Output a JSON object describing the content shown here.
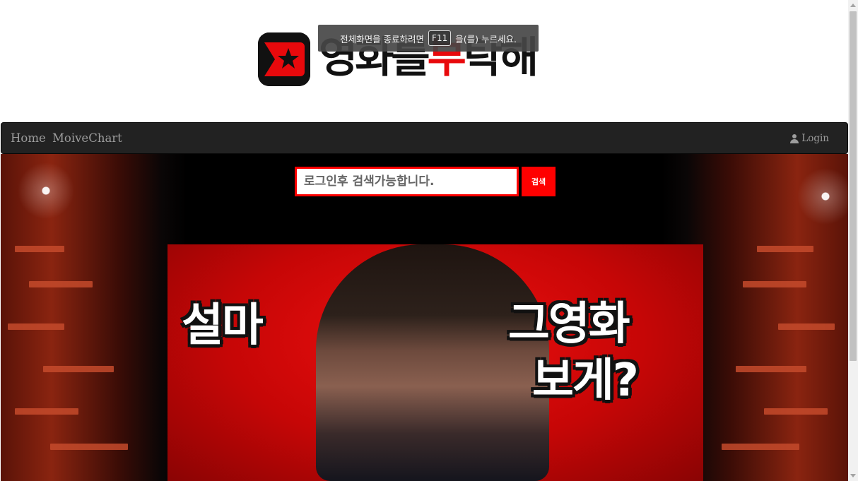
{
  "header": {
    "logo_text_black_1": "영화를",
    "logo_text_red": "부",
    "logo_text_black_2": "탁해"
  },
  "fullscreen_toast": {
    "before_key": "전체화면을 종료하려면",
    "key": "F11",
    "after_key": "을(를) 누르세요."
  },
  "navbar": {
    "home": "Home",
    "chart": "MoiveChart",
    "login": "Login"
  },
  "search": {
    "placeholder": "로그인후 검색가능합니다.",
    "button": "검색"
  },
  "poster": {
    "left_text": "설마",
    "right_line1": "그영화",
    "right_line2": "보게?"
  },
  "colors": {
    "accent": "#ff0000",
    "navbar_bg": "#222222"
  }
}
